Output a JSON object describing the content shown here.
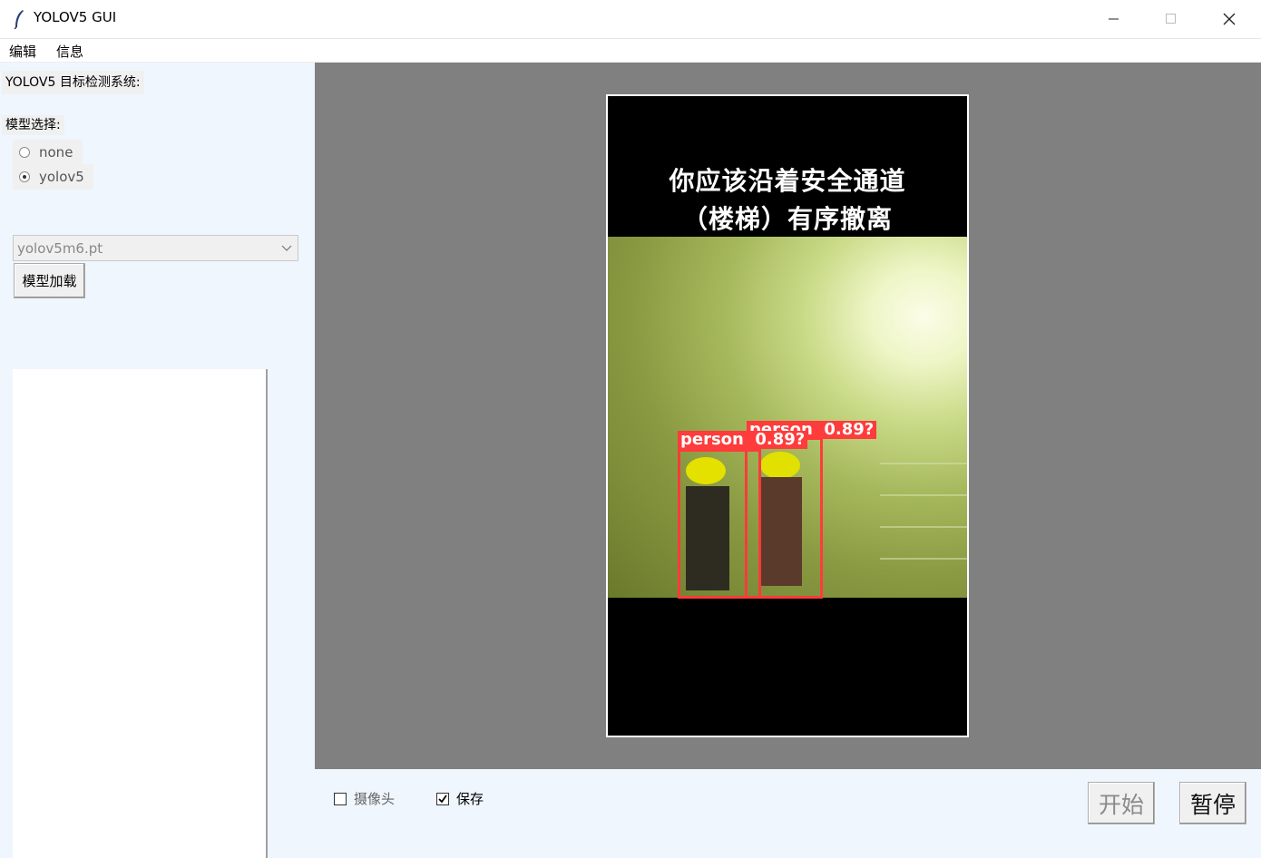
{
  "window": {
    "title": "YOLOV5 GUI"
  },
  "menu": {
    "items": [
      "编辑",
      "信息"
    ]
  },
  "left": {
    "system_label": "YOLOV5 目标检测系统:",
    "model_select_label": "模型选择:",
    "radios": [
      {
        "label": "none",
        "checked": false
      },
      {
        "label": "yolov5",
        "checked": true
      }
    ],
    "weights_combo_value": "yolov5m6.pt",
    "load_button": "模型加载"
  },
  "video": {
    "caption_line1": "你应该沿着安全通道",
    "caption_line2": "（楼梯）有序撤离",
    "detections": [
      {
        "label": "person  0.89?",
        "confidence": 0.89
      },
      {
        "label": "person  0.89?",
        "confidence": 0.89
      }
    ]
  },
  "controls": {
    "camera_checkbox": {
      "label": "摄像头",
      "checked": false
    },
    "save_checkbox": {
      "label": "保存",
      "checked": true
    },
    "start_button": "开始",
    "pause_button": "暂停"
  },
  "colors": {
    "panel_bg": "#f0f6fe",
    "display_bg": "#808080",
    "detection_box": "#ff3b3b"
  }
}
